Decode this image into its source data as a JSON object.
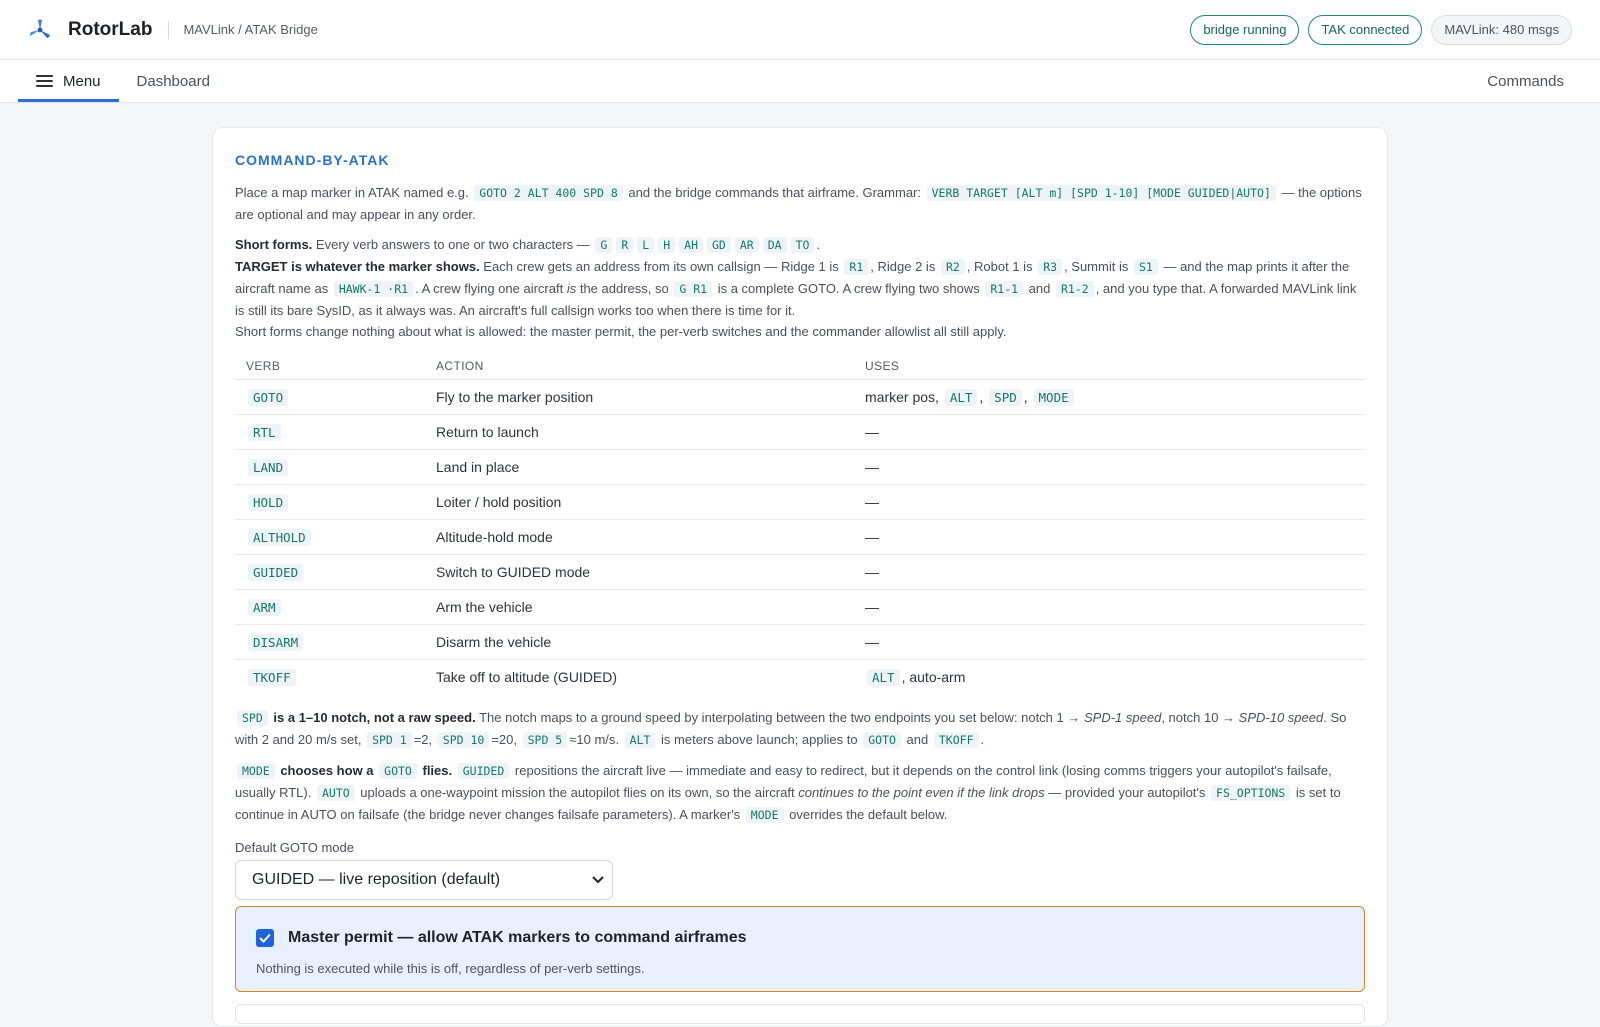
{
  "header": {
    "brand": "RotorLab",
    "subtitle": "MAVLink / ATAK Bridge",
    "status_pills": [
      {
        "label": "bridge running",
        "state": "ok"
      },
      {
        "label": "TAK connected",
        "state": "ok"
      },
      {
        "label": "MAVLink: 480 msgs",
        "state": "neutral"
      }
    ]
  },
  "nav": {
    "menu_label": "Menu",
    "dashboard_label": "Dashboard",
    "commands_label": "Commands"
  },
  "section": {
    "title": "COMMAND-BY-ATAK",
    "intro": {
      "t1": "Place a map marker in ATAK named e.g.",
      "c1": "GOTO 2 ALT 400 SPD 8",
      "t2": "and the bridge commands that airframe. Grammar:",
      "c2": "VERB TARGET [ALT m] [SPD 1-10] [MODE GUIDED|AUTO]",
      "t3": "— the options are optional and may appear in any order."
    },
    "short_forms": {
      "lead": "Short forms.",
      "t1": "Every verb answers to one or two characters —",
      "codes": [
        "G",
        "R",
        "L",
        "H",
        "AH",
        "GD",
        "AR",
        "DA",
        "TO"
      ],
      "t2": "."
    },
    "target": {
      "lead": "TARGET is whatever the marker shows.",
      "t1": "Each crew gets an address from its own callsign — Ridge 1 is",
      "c1": "R1",
      "t2": ", Ridge 2 is",
      "c2": "R2",
      "t3": ", Robot 1 is",
      "c3": "R3",
      "t4": ", Summit is",
      "c4": "S1",
      "t5": "— and the map prints it after the aircraft name as",
      "c5": "HAWK-1 ·R1",
      "t6": ". A crew flying one aircraft",
      "em1": "is",
      "t7": "the address, so",
      "c6": "G R1",
      "t8": "is a complete GOTO. A crew flying two shows",
      "c7": "R1-1",
      "t9": "and",
      "c8": "R1-2",
      "t10": ", and you type that. A forwarded MAVLink link is still its bare SysID, as it always was. An aircraft's full callsign works too when there is time for it."
    },
    "note": "Short forms change nothing about what is allowed: the master permit, the per-verb switches and the commander allowlist all still apply."
  },
  "table": {
    "headers": [
      "VERB",
      "ACTION",
      "USES"
    ],
    "rows": [
      {
        "verb": "GOTO",
        "action": "Fly to the marker position",
        "uses_text": "marker pos,",
        "uses_codes": [
          "ALT",
          "SPD",
          "MODE"
        ],
        "uses_suffix": ""
      },
      {
        "verb": "RTL",
        "action": "Return to launch",
        "uses_text": "—",
        "uses_codes": [],
        "uses_suffix": ""
      },
      {
        "verb": "LAND",
        "action": "Land in place",
        "uses_text": "—",
        "uses_codes": [],
        "uses_suffix": ""
      },
      {
        "verb": "HOLD",
        "action": "Loiter / hold position",
        "uses_text": "—",
        "uses_codes": [],
        "uses_suffix": ""
      },
      {
        "verb": "ALTHOLD",
        "action": "Altitude-hold mode",
        "uses_text": "—",
        "uses_codes": [],
        "uses_suffix": ""
      },
      {
        "verb": "GUIDED",
        "action": "Switch to GUIDED mode",
        "uses_text": "—",
        "uses_codes": [],
        "uses_suffix": ""
      },
      {
        "verb": "ARM",
        "action": "Arm the vehicle",
        "uses_text": "—",
        "uses_codes": [],
        "uses_suffix": ""
      },
      {
        "verb": "DISARM",
        "action": "Disarm the vehicle",
        "uses_text": "—",
        "uses_codes": [],
        "uses_suffix": ""
      },
      {
        "verb": "TKOFF",
        "action": "Take off to altitude (GUIDED)",
        "uses_text": "",
        "uses_codes": [
          "ALT"
        ],
        "uses_suffix": ", auto-arm"
      }
    ]
  },
  "spd": {
    "c0": "SPD",
    "lead": "is a 1–10 notch, not a raw speed.",
    "t1": "The notch maps to a ground speed by interpolating between the two endpoints you set below: notch 1 →",
    "em1": "SPD-1 speed",
    "t2": ", notch 10 →",
    "em2": "SPD-10 speed",
    "t3": ". So with 2 and 20 m/s set,",
    "c1": "SPD 1",
    "t4": "=2,",
    "c2": "SPD 10",
    "t5": "=20,",
    "c3": "SPD 5",
    "t6": "≈10 m/s.",
    "c4": "ALT",
    "t7": "is meters above launch; applies to",
    "c5": "GOTO",
    "t8": "and",
    "c6": "TKOFF",
    "t9": "."
  },
  "mode": {
    "c0": "MODE",
    "lead1": "chooses how a",
    "c1": "GOTO",
    "lead2": "flies.",
    "c2": "GUIDED",
    "t1": "repositions the aircraft live — immediate and easy to redirect, but it depends on the control link (losing comms triggers your autopilot's failsafe, usually RTL).",
    "c3": "AUTO",
    "t2": "uploads a one-waypoint mission the autopilot flies on its own, so the aircraft",
    "em1": "continues to the point even if the link drops",
    "t3": "— provided your autopilot's",
    "c4": "FS_OPTIONS",
    "t4": "is set to continue in AUTO on failsafe (the bridge never changes failsafe parameters). A marker's",
    "c5": "MODE",
    "t5": "overrides the default below."
  },
  "default_mode": {
    "label": "Default GOTO mode",
    "selected": "GUIDED — live reposition (default)"
  },
  "permit": {
    "checked": true,
    "title": "Master permit — allow ATAK markers to command airframes",
    "help": "Nothing is executed while this is off, regardless of per-verb settings."
  },
  "colors": {
    "accent": "#2a6fd3",
    "ok_border": "#22886d",
    "code_text": "#15796a",
    "permit_border": "#c48a2c",
    "permit_bg": "#e9effc"
  }
}
